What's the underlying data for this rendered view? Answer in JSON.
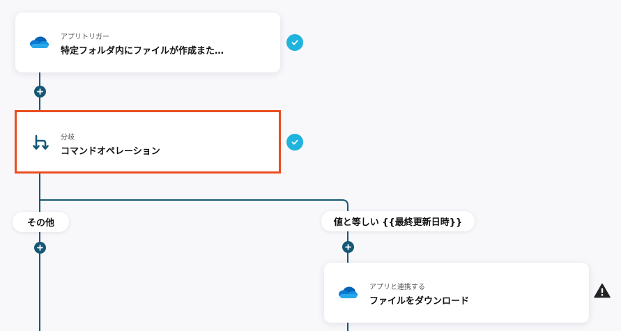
{
  "flow": {
    "trigger": {
      "subtitle": "アプリトリガー",
      "title": "特定フォルダ内にファイルが作成また…",
      "icon": "onedrive-cloud-icon",
      "status": "complete"
    },
    "branch": {
      "subtitle": "分岐",
      "title": "コマンドオペレーション",
      "icon": "branch-icon",
      "status": "complete",
      "selected": true
    },
    "branches": [
      {
        "label": "その他"
      },
      {
        "label": "値と等しい {{最終更新日時}}"
      }
    ],
    "action": {
      "subtitle": "アプリと連携する",
      "title": "ファイルをダウンロード",
      "icon": "onedrive-cloud-icon",
      "status": "warning"
    }
  },
  "colors": {
    "background": "#f8f7fa",
    "connector": "#155876",
    "check": "#1fb4de",
    "selected_border": "#ea4d1f",
    "warning": "#222222"
  }
}
